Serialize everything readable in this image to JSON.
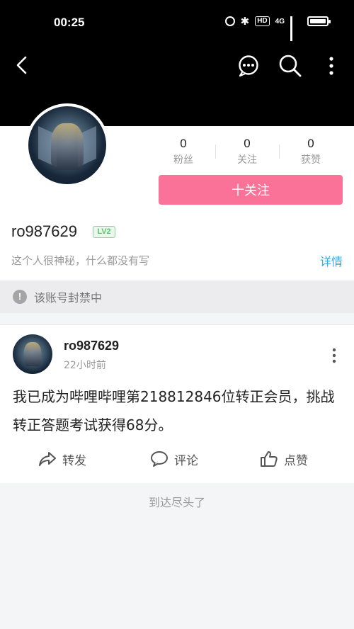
{
  "status_bar": {
    "time": "00:25",
    "hd": "HD",
    "network": "4G"
  },
  "profile": {
    "stats": [
      {
        "value": "0",
        "label": "粉丝"
      },
      {
        "value": "0",
        "label": "关注"
      },
      {
        "value": "0",
        "label": "获赞"
      }
    ],
    "follow_label": "十关注",
    "username": "ro987629",
    "level": "LV2",
    "bio": "这个人很神秘，什么都没有写",
    "detail_label": "详情"
  },
  "banned_notice": {
    "icon": "!",
    "text": "该账号封禁中"
  },
  "post": {
    "username": "ro987629",
    "time": "22小时前",
    "content": "我已成为哔哩哔哩第218812846位转正会员，挑战转正答题考试获得68分。",
    "actions": {
      "share": "转发",
      "comment": "评论",
      "like": "点赞"
    }
  },
  "footer": {
    "end_text": "到达尽头了"
  },
  "colors": {
    "accent_pink": "#fb7299",
    "link_blue": "#23ade5",
    "level_green": "#5cc16e"
  }
}
